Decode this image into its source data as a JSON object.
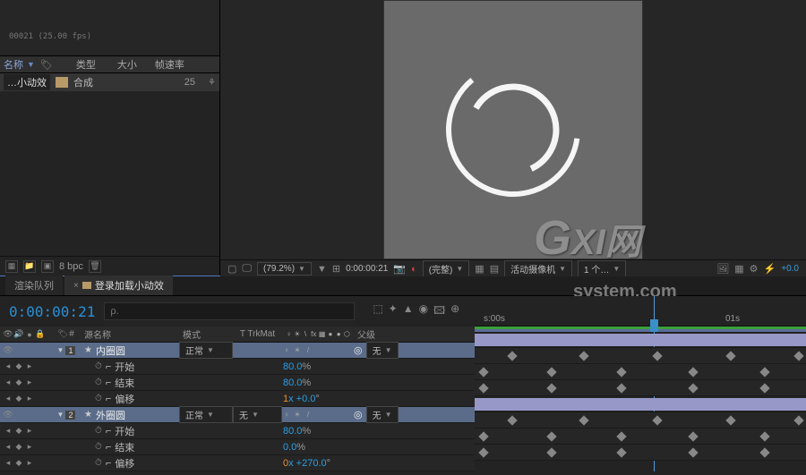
{
  "project": {
    "columns": {
      "name": "名称",
      "type": "类型",
      "size": "大小",
      "fps": "帧速率"
    },
    "item": {
      "label": "…小动效",
      "kind": "合成",
      "fps": "25"
    },
    "footer": {
      "bpc": "8 bpc"
    }
  },
  "preview": {
    "zoom": "(79.2%)",
    "timecode": "0:00:00:21",
    "res": "(完整)",
    "camera": "活动摄像机",
    "views": "1 个…",
    "exposure": "+0.0"
  },
  "tabs": {
    "render": "渲染队列",
    "comp": "登录加载小动效"
  },
  "timeline": {
    "timecode": "0:00:00:21",
    "subframe": "00021 (25.00 fps)",
    "search_placeholder": "ρ.",
    "header": {
      "source": "源名称",
      "mode": "模式",
      "trkmat": "TrkMat",
      "switches": "♀ ☀ \\ fx",
      "parent": "父级"
    },
    "modes": {
      "normal": "正常",
      "none": "无"
    },
    "layer1": {
      "name": "内圈圆"
    },
    "layer2": {
      "name": "外圈圆"
    },
    "props": {
      "start": "开始",
      "end": "结束",
      "offset": "偏移",
      "v_start1": "80.0",
      "pct": "%",
      "v_end1": "80.0",
      "v_offset1_a": "1",
      "v_offset1_b": "x +0.0",
      "deg": "°",
      "v_start2": "80.0",
      "v_end2": "0.0",
      "v_offset2_a": "0",
      "v_offset2_b": "x +270.0"
    },
    "kf_prefix": "⬗"
  },
  "ruler": {
    "t0": "s:00s",
    "t1": "01s"
  },
  "watermark": "GXI网 system.com"
}
